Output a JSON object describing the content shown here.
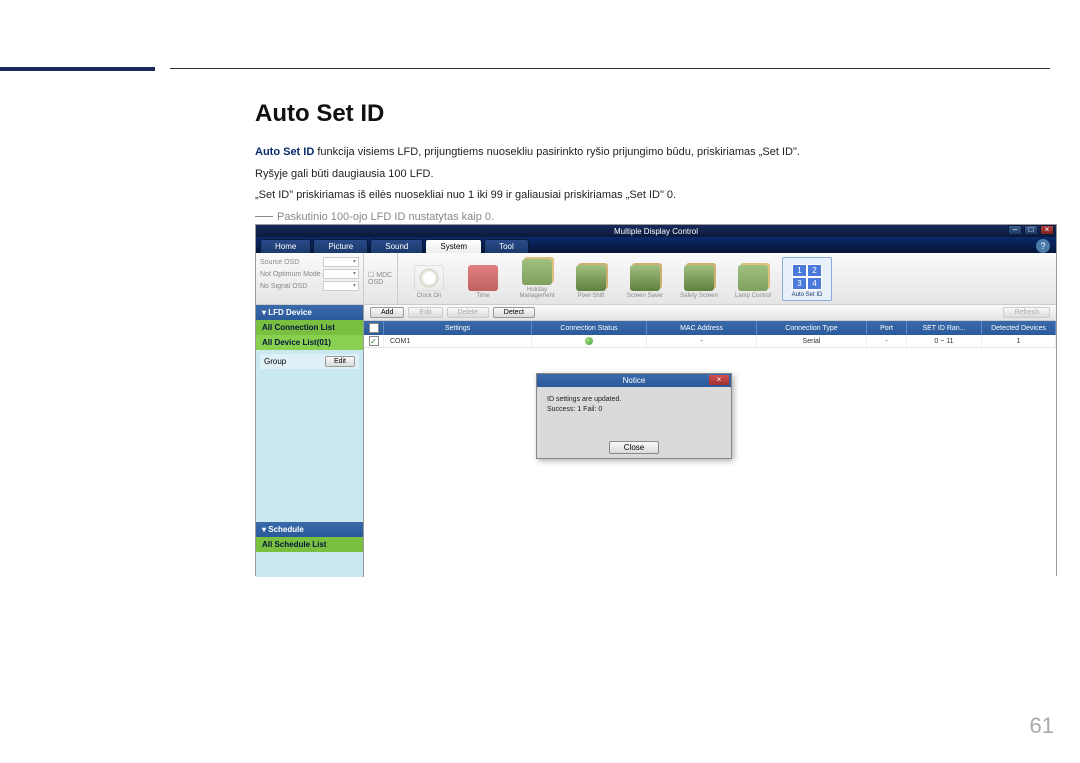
{
  "page_number": "61",
  "doc": {
    "title": "Auto Set ID",
    "p1_bold": "Auto Set ID",
    "p1_rest": " funkcija visiems LFD, prijungtiems nuosekliu pasirinkto ryšio prijungimo būdu, priskiriamas „Set ID\".",
    "p2": "Ryšyje gali būti daugiausia 100 LFD.",
    "p3": "„Set ID\" priskiriamas iš eilės nuosekliai nuo 1 iki 99 ir galiausiai priskiriamas „Set ID\" 0.",
    "note": "Paskutinio 100-ojo LFD ID nustatytas kaip 0."
  },
  "app": {
    "title": "Multiple Display Control",
    "tabs": [
      "Home",
      "Picture",
      "Sound",
      "System",
      "Tool"
    ],
    "active_tab": 3,
    "help": "?",
    "left_rows": [
      {
        "label": "Source OSD",
        "combo": ""
      },
      {
        "label": "Not Optimum Mode OSD",
        "combo": ""
      },
      {
        "label": "No Signal OSD",
        "combo": ""
      }
    ],
    "chk_rows": [
      "MDC OSD"
    ],
    "icons": [
      {
        "name": "clock-on-icon",
        "label": "Clock On",
        "cls": "clock"
      },
      {
        "name": "time-icon",
        "label": "Time",
        "cls": "red"
      },
      {
        "name": "holiday-icon",
        "label": "Holiday Management",
        "cls": "pic"
      },
      {
        "name": "pixel-shift-icon",
        "label": "Pixel Shift",
        "cls": "pic2"
      },
      {
        "name": "screen-saver-icon",
        "label": "Screen Saver",
        "cls": "pic2"
      },
      {
        "name": "safety-screen-icon",
        "label": "Safety Screen",
        "cls": "pic2"
      },
      {
        "name": "lamp-control-icon",
        "label": "Lamp Control",
        "cls": "pic"
      },
      {
        "name": "auto-set-id-icon",
        "label": "Auto Set ID",
        "cls": "blue",
        "active": true
      }
    ],
    "side": {
      "lfd_header": "LFD Device",
      "all_conn": "All Connection List",
      "all_dev": "All Device List(01)",
      "group_label": "Group",
      "edit_btn": "Edit",
      "schedule_header": "Schedule",
      "all_schedule": "All Schedule List"
    },
    "actions": {
      "add": "Add",
      "edit": "Edit",
      "delete": "Delete",
      "detect": "Detect",
      "refresh": "Refresh"
    },
    "columns": [
      "",
      "Settings",
      "Connection Status",
      "MAC Address",
      "Connection Type",
      "Port",
      "SET ID Ran...",
      "Detected Devices"
    ],
    "row": {
      "settings": "COM1",
      "conn": "●",
      "mac": "-",
      "type": "Serial",
      "port": "-",
      "range": "0 ~ 11",
      "detected": "1"
    },
    "dialog": {
      "title": "Notice",
      "line1": "ID settings are updated.",
      "line2": "Success: 1  Fail: 0",
      "close": "Close"
    },
    "win": [
      "–",
      "□",
      "×"
    ]
  }
}
